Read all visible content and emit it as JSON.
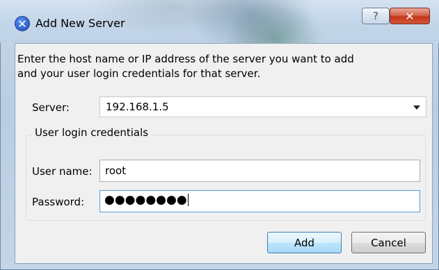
{
  "window": {
    "title": "Add New Server",
    "help_glyph": "?",
    "close_glyph": "✕",
    "title_icon_glyph": "✕"
  },
  "intro": {
    "line1": "Enter the host name or IP address of the server you want to add",
    "line2": "and your user login credentials for that server."
  },
  "server": {
    "label": "Server:",
    "value": "192.168.1.5"
  },
  "credentials": {
    "group_label": "User login credentials",
    "username_label": "User name:",
    "username_value": "root",
    "password_label": "Password:",
    "password_masked": "●●●●●●●●"
  },
  "buttons": {
    "add": "Add",
    "cancel": "Cancel"
  }
}
